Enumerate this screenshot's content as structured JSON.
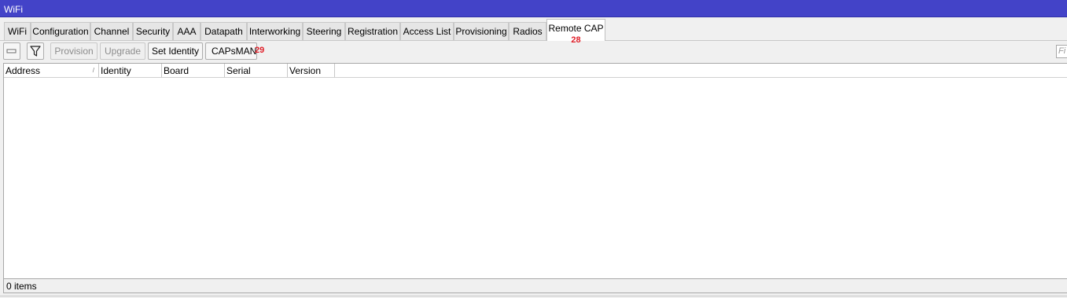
{
  "window": {
    "title": "WiFi"
  },
  "tabs": [
    {
      "label": "WiFi"
    },
    {
      "label": "Configuration"
    },
    {
      "label": "Channel"
    },
    {
      "label": "Security"
    },
    {
      "label": "AAA"
    },
    {
      "label": "Datapath"
    },
    {
      "label": "Interworking"
    },
    {
      "label": "Steering"
    },
    {
      "label": "Registration"
    },
    {
      "label": "Access List"
    },
    {
      "label": "Provisioning"
    },
    {
      "label": "Radios"
    },
    {
      "label": "Remote CAP",
      "active": true,
      "badge": "28"
    }
  ],
  "toolbar": {
    "remove_icon": "minus-icon",
    "filter_icon": "filter-funnel-icon",
    "provision_label": "Provision",
    "upgrade_label": "Upgrade",
    "set_identity_label": "Set Identity",
    "capsman_label": "CAPsMAN",
    "capsman_badge": "29",
    "find_placeholder": "Fi"
  },
  "table": {
    "columns": [
      "Address",
      "Identity",
      "Board",
      "Serial",
      "Version"
    ],
    "sort_column": "Address",
    "rows": []
  },
  "status": {
    "items_text": "0 items"
  },
  "colors": {
    "titlebar": "#4343c8",
    "badge": "#e0202a"
  }
}
